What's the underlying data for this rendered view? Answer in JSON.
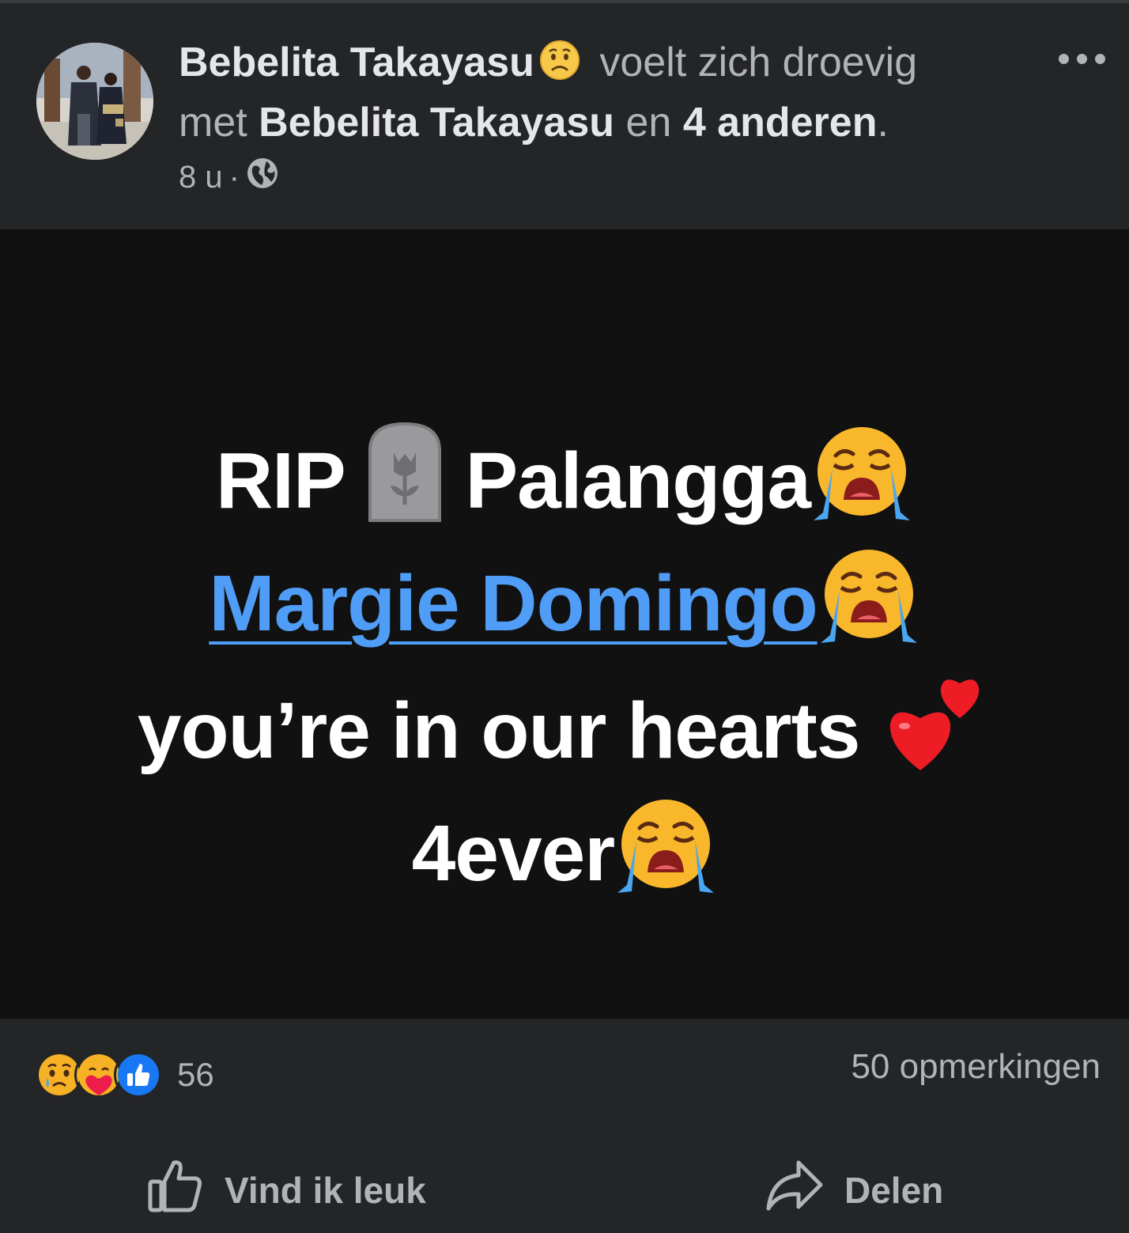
{
  "post": {
    "author": "Bebelita Takayasu",
    "feeling": "voelt zich droevig",
    "feeling_emoji": "sad-face-icon",
    "with_word": "met",
    "tagged": "Bebelita Takayasu",
    "and_word": "en",
    "others": "4 anderen",
    "period": ".",
    "time": "8 u",
    "separator": "·",
    "audience_icon": "globe-icon"
  },
  "message": {
    "rip": "RIP",
    "name": "Palangga",
    "mention": "Margie Domingo",
    "line3": "you’re in our hearts",
    "line4": "4ever",
    "emojis": [
      "headstone-icon",
      "crying-face-icon",
      "two-hearts-icon"
    ]
  },
  "footer": {
    "reaction_icons": [
      "sad-reaction-icon",
      "care-reaction-icon",
      "like-reaction-icon"
    ],
    "reaction_count": "56",
    "comments": "50 opmerkingen",
    "like_label": "Vind ik leuk",
    "share_label": "Delen"
  },
  "colors": {
    "background": "#242526",
    "content_bg": "#111112",
    "mention": "#4f9df6",
    "text": "#e4e6eb",
    "muted": "#b0b3b8"
  }
}
